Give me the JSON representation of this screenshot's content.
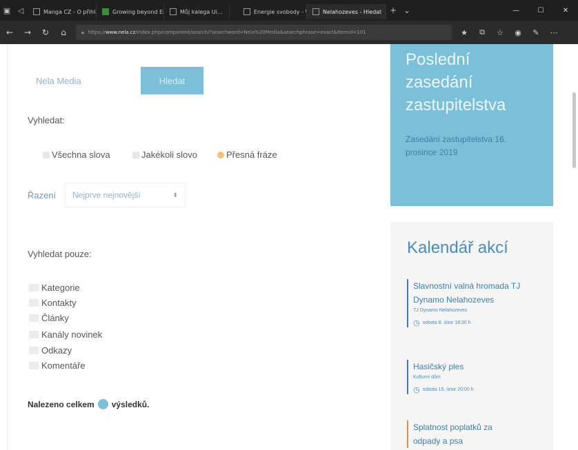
{
  "browser": {
    "tabs": [
      {
        "title": "Manga CZ - O přihlašování"
      },
      {
        "title": "Growing beyond Earth · Nat..."
      },
      {
        "title": "Můj kalega Ui..."
      },
      {
        "title": "Energie svobody - Web"
      },
      {
        "title": "Nelahozeves - Hledat",
        "active": true
      }
    ],
    "url_prefix": "https://",
    "url_domain": "www.nela.cz",
    "url_rest": "/index.php/component/search/?searchword=Nela%20Media&searchphrase=exact&Itemid=101"
  },
  "search": {
    "input_value": "Nela Media",
    "button_label": "Hledat",
    "search_label": "Vyhledat:",
    "options": [
      {
        "label": "Všechna slova",
        "selected": false
      },
      {
        "label": "Jakékoli slovo",
        "selected": false
      },
      {
        "label": "Přesná fráze",
        "selected": true
      }
    ],
    "sort_label": "Řazení",
    "sort_value": "Nejprve nejnovější",
    "only_label": "Vyhledat pouze:",
    "areas": [
      "Kategorie",
      "Kontakty",
      "Články",
      "Kanály novinek",
      "Odkazy",
      "Komentáře"
    ],
    "result_prefix": "Nalezeno celkem",
    "result_suffix": "výsledků."
  },
  "sidebar": {
    "meeting": {
      "title": "Poslední zasedání zastupitelstva",
      "text": "Zasedání zastupitelstva 16. prosince 2019"
    },
    "calendar": {
      "title": "Kalendář akcí",
      "events": [
        {
          "title": "Slavnostní valná hromada TJ Dynamo Nelahozeves",
          "organizer": "TJ Dynamo Nelahozeves",
          "date": "sobota 8. únor 18:30 h",
          "color": "#3a78c0"
        },
        {
          "title": "Hasičský ples",
          "organizer": "Kulturní dům",
          "date": "sobota 15. únor 20:00 h",
          "color": "#3a78c0"
        },
        {
          "title": "Splatnost poplatků za odpady a psa",
          "organizer": "",
          "date": "",
          "color": "#e58b3a"
        }
      ]
    }
  },
  "colors": {
    "accent": "#7bbfd9",
    "link": "#4a8cba"
  }
}
